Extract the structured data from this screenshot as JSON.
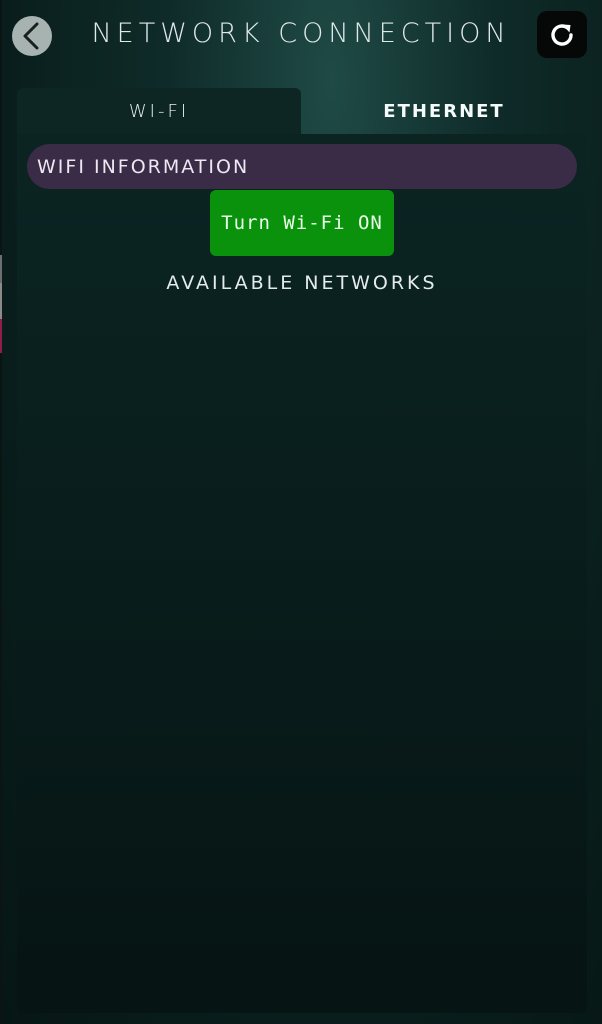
{
  "header": {
    "title": "NETWORK CONNECTION",
    "back_icon": "chevron-left-icon",
    "refresh_icon": "refresh-icon"
  },
  "tabs": [
    {
      "label": "WI-FI",
      "active": true
    },
    {
      "label": "ETHERNET",
      "active": false
    }
  ],
  "wifi": {
    "info_label": "WIFI INFORMATION",
    "toggle_label": "Turn Wi-Fi ON",
    "networks_heading": "AVAILABLE NETWORKS",
    "networks": []
  },
  "colors": {
    "toggle_button": "#0a920d",
    "info_bar": "#3a2b47",
    "background": "#0b2422"
  }
}
